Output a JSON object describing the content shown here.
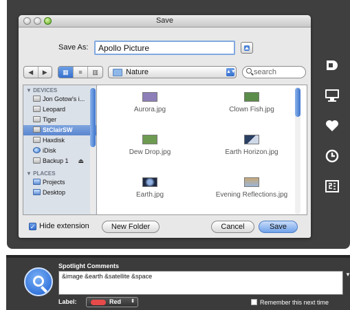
{
  "dialog": {
    "title": "Save",
    "save_as_label": "Save As:",
    "save_as_value": "Apollo Picture",
    "location": "Nature",
    "search_placeholder": "search"
  },
  "sidebar": {
    "devices_header": "▼ DEVICES",
    "places_header": "▼ PLACES",
    "devices": [
      {
        "label": "Jon Gotow's i..."
      },
      {
        "label": "Leopard"
      },
      {
        "label": "Tiger"
      },
      {
        "label": "StClairSW"
      },
      {
        "label": "Haxdisk"
      },
      {
        "label": "iDisk"
      },
      {
        "label": "Backup 1"
      }
    ],
    "places": [
      {
        "label": "Projects"
      },
      {
        "label": "Desktop"
      }
    ]
  },
  "files": [
    {
      "name": "Aurora.jpg",
      "color": "#8e7fb8"
    },
    {
      "name": "Clown Fish.jpg",
      "color": "#5b8c4a"
    },
    {
      "name": "Dew Drop.jpg",
      "color": "#6e9b52"
    },
    {
      "name": "Earth Horizon.jpg",
      "color": "#2b3f63"
    },
    {
      "name": "Earth.jpg",
      "color": "#3b4d7a"
    },
    {
      "name": "Evening Reflections.jpg",
      "color": "#c7a978"
    }
  ],
  "bottom": {
    "hide_extension": "Hide extension",
    "new_folder": "New Folder",
    "cancel": "Cancel",
    "save": "Save"
  },
  "spotlight": {
    "title": "Spotlight Comments",
    "comments": "&image &earth &satellite &space",
    "label_label": "Label:",
    "label_value": "Red",
    "remember": "Remember this next time"
  }
}
